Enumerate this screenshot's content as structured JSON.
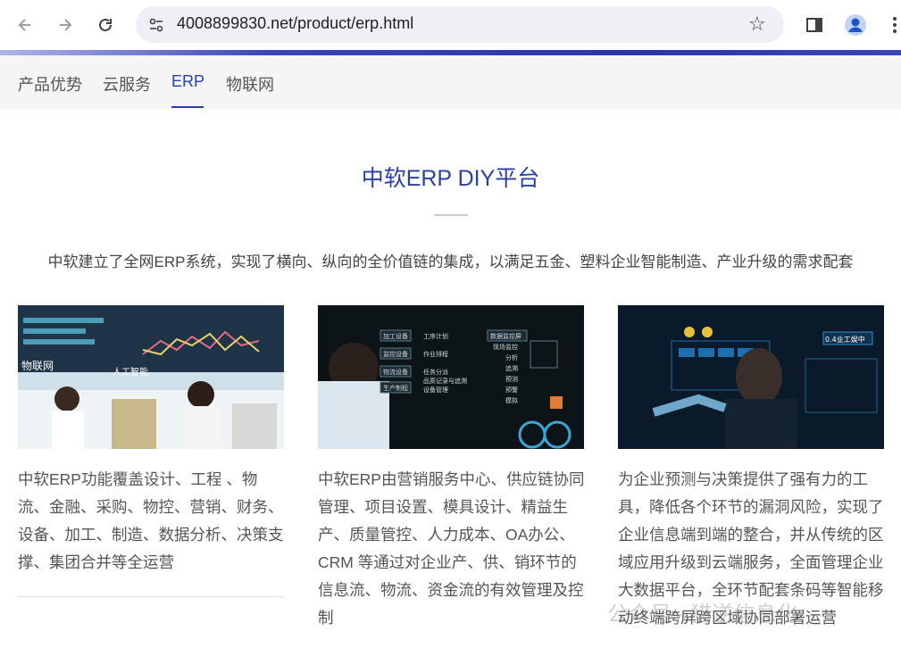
{
  "browser": {
    "url": "4008899830.net/product/erp.html",
    "back_icon": "arrow-left",
    "forward_icon": "arrow-right",
    "reload_icon": "reload",
    "site_settings_icon": "tune",
    "bookmark_icon": "star",
    "sidepanel_icon": "side-panel",
    "profile_icon": "person",
    "menu_icon": "kebab-menu"
  },
  "tabs": [
    "产品优势",
    "云服务",
    "ERP",
    "物联网"
  ],
  "active_tab": "ERP",
  "page": {
    "title": "中软ERP DIY平台",
    "intro": "中软建立了全网ERP系统，实现了横向、纵向的全价值链的集成，以满足五金、塑料企业智能制造、产业升级的需求配套"
  },
  "cards": [
    {
      "image_labels": [
        "物联网",
        "人工智能"
      ],
      "text": "中软ERP功能覆盖设计、工程 、物流、金融、采购、物控、营销、财务、设备、加工、制造、数据分析、决策支撑、集团合并等全运营"
    },
    {
      "image_labels": [
        "加工设备",
        "监控设备",
        "物流设备",
        "生产制程",
        "工序计划",
        "作业排程",
        "任务分派",
        "品质记录与追溯",
        "设备管理",
        "数据监控屏",
        "现场监控",
        "分析",
        "追溯",
        "预测",
        "预警",
        "模拟"
      ],
      "text": "中软ERP由营销服务中心、供应链协同管理、项目设置、模具设计、精益生产、质量管控、人力成本、OA办公、CRM 等通过对企业产、供、销环节的信息流、物流、资金流的有效管理及控制"
    },
    {
      "image_labels": [
        "0.4业工娱中"
      ],
      "text": "为企业预测与决策提供了强有力的工具，降低各个环节的漏洞风险，实现了企业信息端到端的整合，并从传统的区域应用升级到云端服务，全面管理企业大数据平台，全环节配套条码等智能移动终端跨屏跨区域协同部署运营"
    }
  ],
  "watermark": "公众号 · 猎逆信息化"
}
